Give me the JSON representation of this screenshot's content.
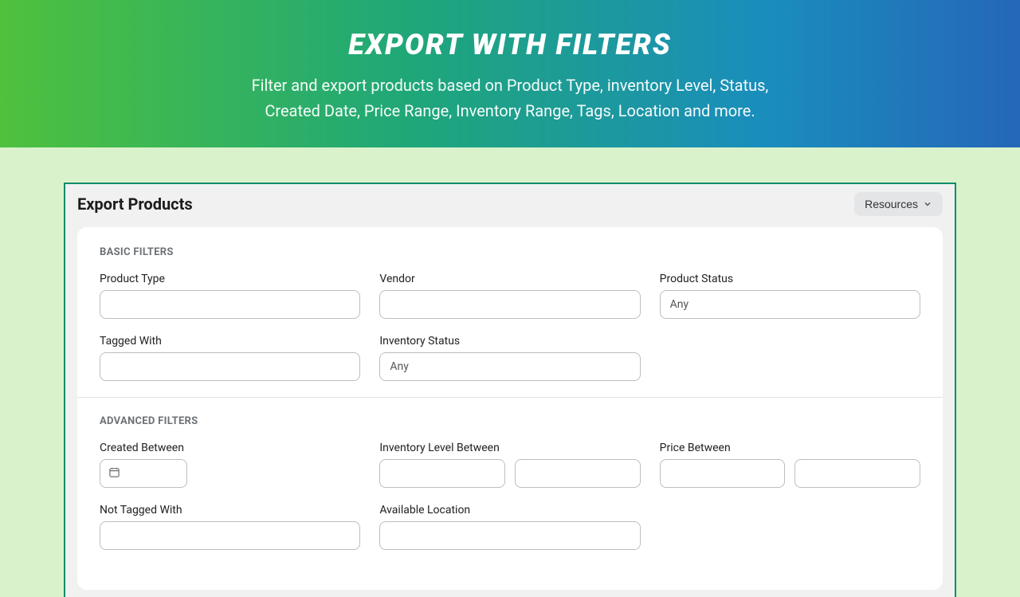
{
  "hero": {
    "title": "EXPORT WITH FILTERS",
    "subtitle_line1": "Filter and export products based on Product Type, inventory Level, Status,",
    "subtitle_line2": "Created Date, Price Range, Inventory Range, Tags, Location and more."
  },
  "panel": {
    "title": "Export Products",
    "resources_label": "Resources"
  },
  "basic": {
    "heading": "BASIC FILTERS",
    "product_type_label": "Product Type",
    "vendor_label": "Vendor",
    "product_status_label": "Product Status",
    "product_status_value": "Any",
    "tagged_with_label": "Tagged With",
    "inventory_status_label": "Inventory Status",
    "inventory_status_value": "Any"
  },
  "advanced": {
    "heading": "ADVANCED FILTERS",
    "created_between_label": "Created Between",
    "inventory_level_label": "Inventory Level Between",
    "price_between_label": "Price Between",
    "not_tagged_label": "Not Tagged With",
    "available_location_label": "Available Location"
  }
}
